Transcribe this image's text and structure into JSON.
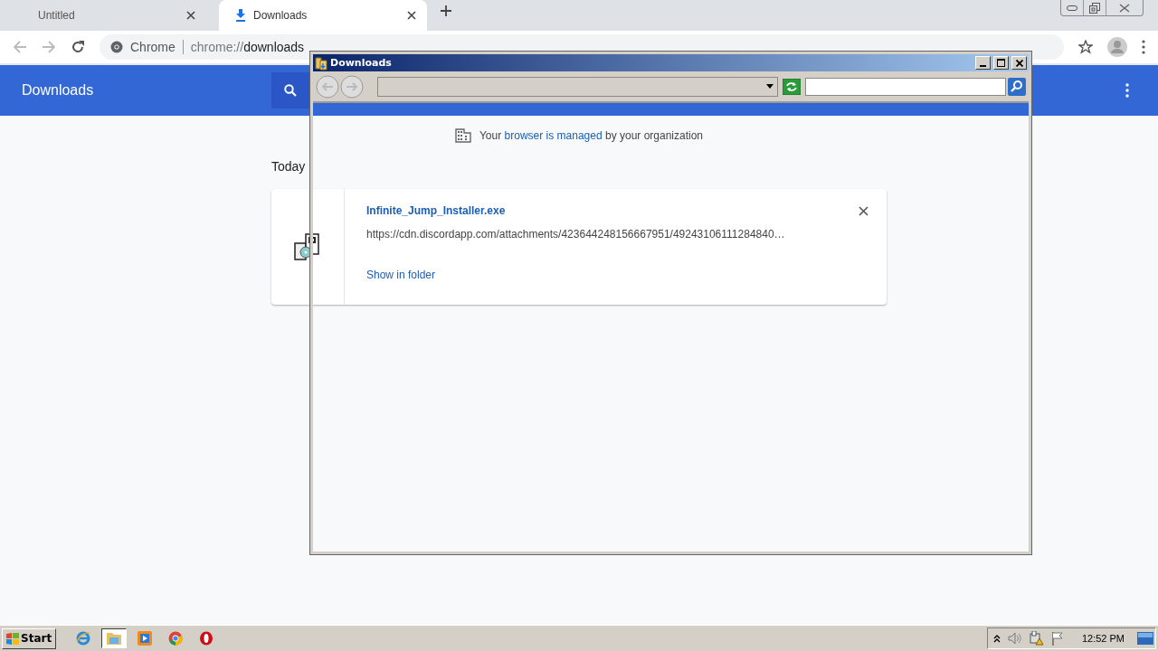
{
  "browser": {
    "tabs": [
      {
        "title": "Untitled",
        "selected": false,
        "kind": "blank"
      },
      {
        "title": "Downloads",
        "selected": true,
        "kind": "download"
      }
    ],
    "address": {
      "site_label": "Chrome",
      "url_prefix": "chrome://",
      "url_rest": "downloads"
    }
  },
  "downloads_page": {
    "title": "Downloads",
    "notice_before": "Your",
    "notice_link": "browser is managed",
    "notice_after": "by your organization",
    "section": "Today",
    "items": [
      {
        "filename": "Infinite_Jump_Installer.exe",
        "url": "https://cdn.discordapp.com/attachments/423644248156667951/49243106111284840…",
        "action": "Show in folder"
      }
    ]
  },
  "explorer_window": {
    "title": "Downloads"
  },
  "taskbar": {
    "start": "Start",
    "apps": [
      {
        "kind": "ie",
        "selected": false
      },
      {
        "kind": "explorer",
        "selected": true
      },
      {
        "kind": "media",
        "selected": false
      },
      {
        "kind": "chrome",
        "selected": false
      },
      {
        "kind": "opera",
        "selected": false
      }
    ],
    "clock": "12:52 PM"
  }
}
